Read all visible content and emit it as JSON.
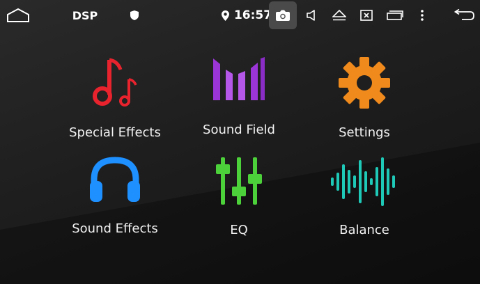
{
  "status_bar": {
    "app_title": "DSP",
    "time": "16:57",
    "icons": [
      "home-icon",
      "shield-icon",
      "location-icon",
      "camera-icon",
      "volume-icon",
      "eject-icon",
      "close-window-icon",
      "window-icon",
      "more-icon",
      "back-icon"
    ]
  },
  "tiles": [
    {
      "label": "Special Effects",
      "icon": "music-note-icon",
      "color": "#e8232e"
    },
    {
      "label": "Sound Field",
      "icon": "sound-field-icon",
      "color": "#9b35d8"
    },
    {
      "label": "Settings",
      "icon": "gear-icon",
      "color": "#f08a1c"
    },
    {
      "label": "Sound Effects",
      "icon": "headphones-icon",
      "color": "#1e90ff"
    },
    {
      "label": "EQ",
      "icon": "equalizer-icon",
      "color": "#4cd13a"
    },
    {
      "label": "Balance",
      "icon": "waveform-icon",
      "color": "#1fc9b7"
    }
  ]
}
